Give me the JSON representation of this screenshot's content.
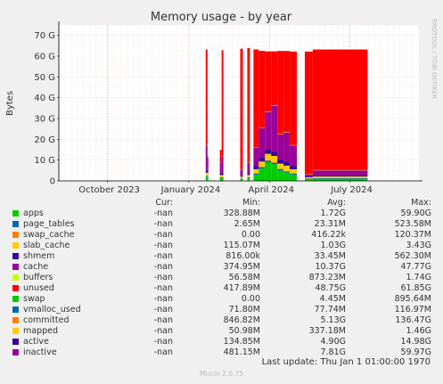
{
  "side_label": "RRDTOOL / TOBI OETIKER",
  "chart_data": {
    "type": "area",
    "title": "Memory usage - by year",
    "ylabel": "Bytes",
    "xlabel": "",
    "ylim": [
      0,
      75
    ],
    "y_unit": "G",
    "y_ticks": [
      {
        "value": 0,
        "label": "0"
      },
      {
        "value": 10,
        "label": "10 G"
      },
      {
        "value": 20,
        "label": "20 G"
      },
      {
        "value": 30,
        "label": "30 G"
      },
      {
        "value": 40,
        "label": "40 G"
      },
      {
        "value": 50,
        "label": "50 G"
      },
      {
        "value": 60,
        "label": "60 G"
      },
      {
        "value": 70,
        "label": "70 G"
      }
    ],
    "xlim": [
      "2023-08-07",
      "2024-09-17"
    ],
    "x_ticks": [
      {
        "date": "2023-10-01",
        "label": "October 2023"
      },
      {
        "date": "2024-01-01",
        "label": "January 2024"
      },
      {
        "date": "2024-04-01",
        "label": "April 2024"
      },
      {
        "date": "2024-07-01",
        "label": "July 2024"
      }
    ],
    "grid": true,
    "series": [
      {
        "name": "apps",
        "color": "#00cc00"
      },
      {
        "name": "page_tables",
        "color": "#0066b3"
      },
      {
        "name": "swap_cache",
        "color": "#ff8000"
      },
      {
        "name": "slab_cache",
        "color": "#ffcc00"
      },
      {
        "name": "shmem",
        "color": "#330099"
      },
      {
        "name": "cache",
        "color": "#990099"
      },
      {
        "name": "buffers",
        "color": "#ccff00"
      },
      {
        "name": "unused",
        "color": "#ff0000"
      }
    ],
    "stacks": [
      {
        "start": "2024-01-20",
        "end": "2024-01-22",
        "values": [
          2.0,
          0.4,
          0,
          1.5,
          1.2,
          12.0,
          0.1,
          46.0
        ]
      },
      {
        "start": "2024-01-22",
        "end": "2024-01-23",
        "values": [
          2.0,
          0.4,
          0,
          1.5,
          1.2,
          6.0,
          0.1,
          0.5
        ]
      },
      {
        "start": "2024-02-05",
        "end": "2024-02-07",
        "values": [
          1.5,
          0.3,
          0,
          1.0,
          1.0,
          5.0,
          0.1,
          6.0
        ]
      },
      {
        "start": "2024-02-07",
        "end": "2024-02-09",
        "values": [
          1.5,
          0.3,
          0,
          1.0,
          1.0,
          8.0,
          0.1,
          51.0
        ]
      },
      {
        "start": "2024-02-28",
        "end": "2024-03-02",
        "values": [
          1.0,
          0.2,
          0,
          0.8,
          0.5,
          3.0,
          0.1,
          58.0
        ]
      },
      {
        "start": "2024-03-07",
        "end": "2024-03-10",
        "values": [
          1.5,
          0.3,
          0,
          1.0,
          1.0,
          5.0,
          0.1,
          55.0
        ]
      },
      {
        "start": "2024-03-14",
        "end": "2024-03-20",
        "values": [
          3.0,
          0.5,
          0.1,
          2.0,
          1.5,
          9.0,
          0.1,
          47.0
        ]
      },
      {
        "start": "2024-03-20",
        "end": "2024-03-27",
        "values": [
          6.0,
          0.6,
          0.2,
          2.5,
          2.0,
          14.0,
          0.2,
          37.0
        ]
      },
      {
        "start": "2024-03-27",
        "end": "2024-04-03",
        "values": [
          9.0,
          0.7,
          0.3,
          3.0,
          2.0,
          18.0,
          0.3,
          29.0
        ]
      },
      {
        "start": "2024-04-03",
        "end": "2024-04-10",
        "values": [
          8.0,
          0.7,
          0.3,
          3.0,
          2.0,
          22.0,
          0.3,
          26.0
        ]
      },
      {
        "start": "2024-04-10",
        "end": "2024-04-17",
        "values": [
          5.0,
          0.6,
          0.2,
          2.5,
          2.0,
          12.0,
          0.2,
          40.0
        ]
      },
      {
        "start": "2024-04-17",
        "end": "2024-04-24",
        "values": [
          4.0,
          0.6,
          0.2,
          2.5,
          2.0,
          14.0,
          0.2,
          39.0
        ]
      },
      {
        "start": "2024-04-24",
        "end": "2024-05-02",
        "values": [
          3.0,
          0.5,
          0.1,
          2.0,
          1.5,
          10.0,
          0.1,
          45.0
        ]
      },
      {
        "start": "2024-05-11",
        "end": "2024-05-20",
        "values": [
          0.8,
          0.3,
          0,
          0.6,
          0.4,
          1.0,
          0.1,
          59.0
        ]
      },
      {
        "start": "2024-05-20",
        "end": "2024-07-21",
        "values": [
          1.0,
          0.3,
          0,
          0.8,
          0.5,
          2.5,
          0.1,
          58.0
        ]
      }
    ]
  },
  "legend": {
    "headers": {
      "cur": "Cur:",
      "min": "Min:",
      "avg": "Avg:",
      "max": "Max:"
    },
    "rows": [
      {
        "name": "apps",
        "color": "#00cc00",
        "cur": "-nan",
        "min": "328.88M",
        "avg": "1.72G",
        "max": "59.90G"
      },
      {
        "name": "page_tables",
        "color": "#0066b3",
        "cur": "-nan",
        "min": "2.65M",
        "avg": "23.31M",
        "max": "523.58M"
      },
      {
        "name": "swap_cache",
        "color": "#ff8000",
        "cur": "-nan",
        "min": "0.00",
        "avg": "416.22k",
        "max": "120.37M"
      },
      {
        "name": "slab_cache",
        "color": "#ffcc00",
        "cur": "-nan",
        "min": "115.07M",
        "avg": "1.03G",
        "max": "3.43G"
      },
      {
        "name": "shmem",
        "color": "#330099",
        "cur": "-nan",
        "min": "816.00k",
        "avg": "33.45M",
        "max": "562.30M"
      },
      {
        "name": "cache",
        "color": "#990099",
        "cur": "-nan",
        "min": "374.95M",
        "avg": "10.37G",
        "max": "47.77G"
      },
      {
        "name": "buffers",
        "color": "#ccff00",
        "cur": "-nan",
        "min": "56.58M",
        "avg": "873.23M",
        "max": "1.74G"
      },
      {
        "name": "unused",
        "color": "#ff0000",
        "cur": "-nan",
        "min": "417.89M",
        "avg": "48.75G",
        "max": "61.85G"
      },
      {
        "name": "swap",
        "color": "#00cc00",
        "cur": "-nan",
        "min": "0.00",
        "avg": "4.45M",
        "max": "895.64M"
      },
      {
        "name": "vmalloc_used",
        "color": "#0066b3",
        "cur": "-nan",
        "min": "71.80M",
        "avg": "77.74M",
        "max": "116.97M"
      },
      {
        "name": "committed",
        "color": "#ff8000",
        "cur": "-nan",
        "min": "846.82M",
        "avg": "5.13G",
        "max": "136.47G"
      },
      {
        "name": "mapped",
        "color": "#ffcc00",
        "cur": "-nan",
        "min": "50.98M",
        "avg": "337.18M",
        "max": "1.46G"
      },
      {
        "name": "active",
        "color": "#330099",
        "cur": "-nan",
        "min": "134.85M",
        "avg": "4.90G",
        "max": "14.98G"
      },
      {
        "name": "inactive",
        "color": "#990099",
        "cur": "-nan",
        "min": "481.15M",
        "avg": "7.81G",
        "max": "59.97G"
      }
    ]
  },
  "last_update": "Last update: Thu Jan  1 01:00:00 1970",
  "footer": "Munin 2.0.75"
}
